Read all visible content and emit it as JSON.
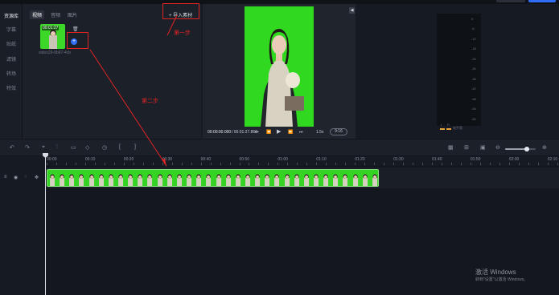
{
  "colors": {
    "accent": "#2f6df6",
    "greenscreen": "#31d820",
    "annotation": "#e02424",
    "meter_level": "#e8a33a"
  },
  "left_nav": {
    "items": [
      {
        "label": "资源库",
        "active": true
      },
      {
        "label": "字幕",
        "active": false
      },
      {
        "label": "贴纸",
        "active": false
      },
      {
        "label": "滤镜",
        "active": false
      },
      {
        "label": "转场",
        "active": false
      },
      {
        "label": "特效",
        "active": false
      }
    ]
  },
  "media": {
    "tabs": [
      {
        "label": "视频",
        "active": true
      },
      {
        "label": "音频",
        "active": false
      },
      {
        "label": "图片",
        "active": false
      }
    ],
    "import_label": "+ 导入素材",
    "item": {
      "duration": "00:01:27",
      "filename": "video29-9b67-4cb",
      "icons": [
        "trash-icon",
        "plus-circle-icon"
      ]
    }
  },
  "preview": {
    "timecode": "00:00:00.000",
    "total": "/ 00:01:27.866",
    "speed": "1.5x",
    "ratio": "9:16",
    "icons": [
      "collapse-icon",
      "frame-back-icon",
      "rewind-icon",
      "play-icon",
      "forward-icon",
      "frame-forward-icon"
    ]
  },
  "meter": {
    "ticks": [
      "0",
      "-6",
      "-12",
      "-18",
      "-24",
      "-30",
      "-36",
      "-42",
      "-48",
      "-54",
      "-60"
    ],
    "channels": [
      "L",
      "R"
    ],
    "caption": "电平表"
  },
  "toolbar": {
    "left_icons": [
      "undo-icon",
      "redo-icon",
      "cursor-icon",
      "split-icon",
      "delete-icon",
      "keyframe-icon",
      "freeze-icon",
      "mark-in-icon",
      "mark-out-icon"
    ],
    "right_icons": [
      "grid-icon",
      "fit-icon",
      "snapshot-icon",
      "zoom-out-icon",
      "zoom-in-icon"
    ],
    "zoom_level": 0.7
  },
  "ruler": {
    "labels": [
      "00:00",
      "00:10",
      "00:20",
      "00:30",
      "00:40",
      "00:50",
      "01:00",
      "01:10",
      "01:20",
      "01:30",
      "01:40",
      "01:50",
      "02:00",
      "02:10"
    ]
  },
  "track": {
    "icons": [
      "menu-icon",
      "eye-icon",
      "lock-icon",
      "move-icon"
    ],
    "clip_frames": 34
  },
  "annotations": {
    "step1": "第一步",
    "step2": "第二步"
  },
  "watermark": {
    "line1": "激活 Windows",
    "line2": "转到\"设置\"以激活 Windows。"
  }
}
